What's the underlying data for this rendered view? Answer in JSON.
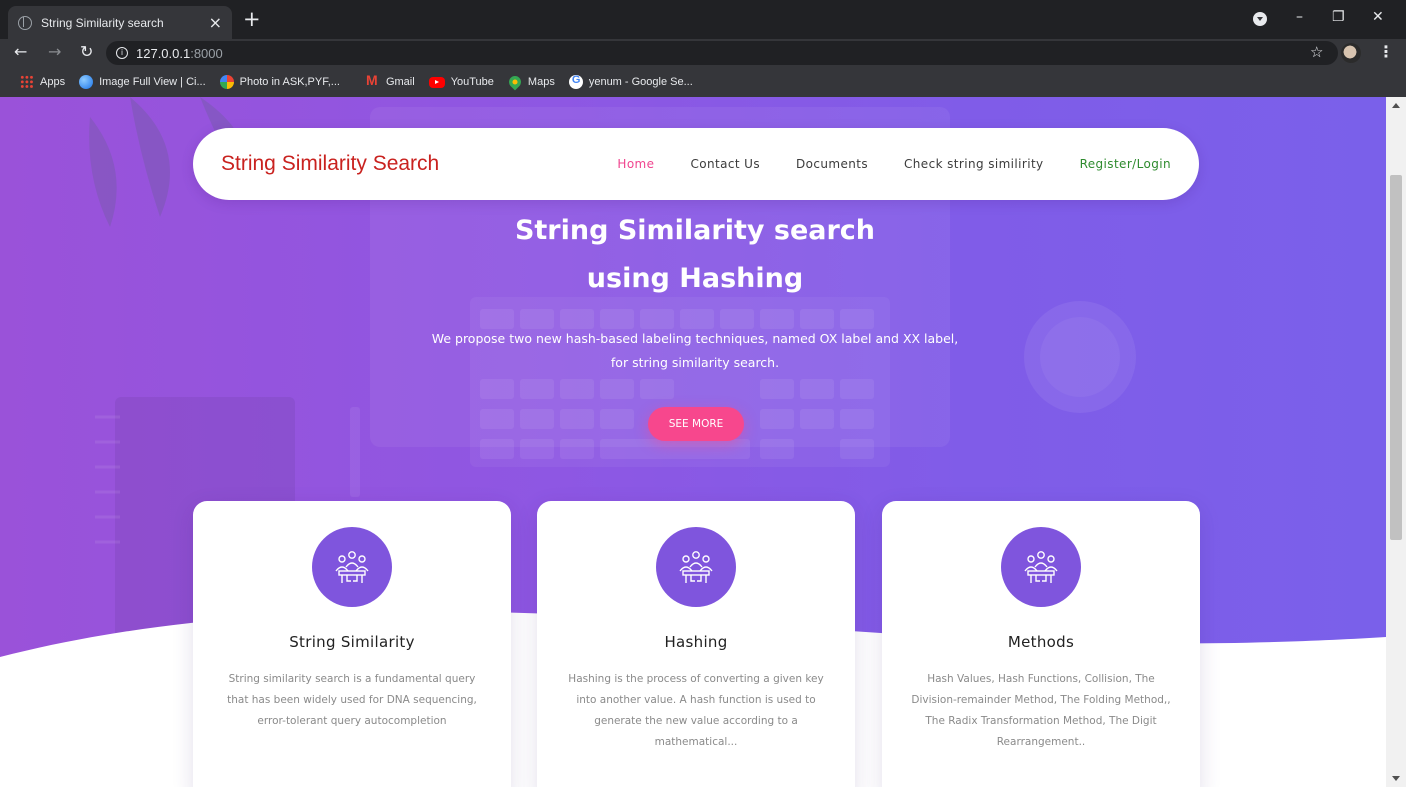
{
  "browser": {
    "tab_title": "String Similarity search",
    "tab_close": "×",
    "new_tab": "+",
    "url_host": "127.0.0.1",
    "url_port": ":8000",
    "window_controls": {
      "minimize": "–",
      "maximize": "❐",
      "close": "✕"
    },
    "bookmarks": [
      {
        "label": "Apps",
        "icon": "apps-grid-icon"
      },
      {
        "label": "Image Full View | Ci...",
        "icon": "globe-icon"
      },
      {
        "label": "Photo in ASK,PYF,...",
        "icon": "photos-pinwheel-icon"
      },
      {
        "label": "Gmail",
        "icon": "gmail-icon"
      },
      {
        "label": "YouTube",
        "icon": "youtube-icon"
      },
      {
        "label": "Maps",
        "icon": "maps-pin-icon"
      },
      {
        "label": "yenum - Google Se...",
        "icon": "google-icon"
      }
    ]
  },
  "navbar": {
    "brand": "String Similarity Search",
    "links": [
      {
        "label": "Home",
        "active": true
      },
      {
        "label": "Contact Us"
      },
      {
        "label": "Documents"
      },
      {
        "label": "Check string similirity"
      },
      {
        "label": "Register/Login"
      }
    ]
  },
  "hero": {
    "title_prefix": "String Similarity",
    "title_bold_1": "search",
    "title_prefix_2": "using",
    "title_bold_2": "Hashing",
    "subtitle": "We propose two new hash-based labeling techniques, named OX label and XX label, for string similarity search.",
    "cta_label": "SEE MORE"
  },
  "cards": [
    {
      "icon": "meeting-team-icon",
      "title": "String Similarity",
      "text": "String similarity search is a fundamental query that has been widely used for DNA sequencing, error-tolerant query autocompletion"
    },
    {
      "icon": "meeting-team-icon",
      "title": "Hashing",
      "text": "Hashing is the process of converting a given key into another value. A hash function is used to generate the new value according to a mathematical..."
    },
    {
      "icon": "meeting-team-icon",
      "title": "Methods",
      "text": "Hash Values, Hash Functions, Collision, The Division-remainder Method, The Folding Method,, The Radix Transformation Method, The Digit Rearrangement.."
    }
  ],
  "colors": {
    "brand": "#c9221f",
    "accent_pink": "#f7478d",
    "hero_purple": "#8e57e3",
    "icon_circle": "#7f55dd",
    "register_green": "#2e8b2e"
  }
}
